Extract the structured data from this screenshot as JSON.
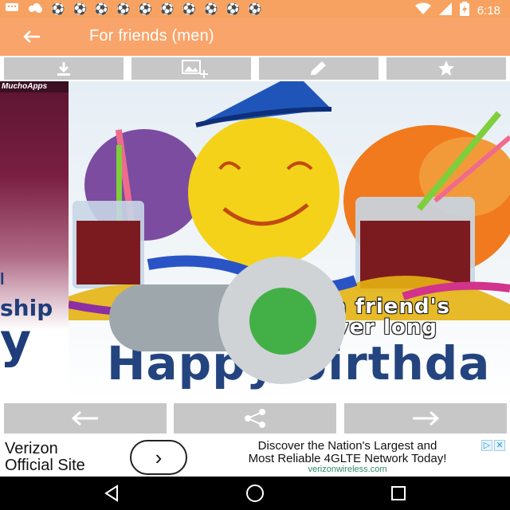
{
  "status_bar": {
    "time": "6:18",
    "notification_icons": [
      "message-icon",
      "cloud-icon",
      "soccer-ball-icon",
      "soccer-ball-icon",
      "soccer-ball-icon",
      "soccer-ball-icon",
      "soccer-ball-icon",
      "soccer-ball-icon",
      "soccer-ball-icon",
      "soccer-ball-icon",
      "soccer-ball-icon",
      "soccer-ball-icon"
    ],
    "right_icons": [
      "wifi-icon",
      "signal-icon",
      "battery-charging-icon"
    ]
  },
  "app_bar": {
    "title": "For friends (men)",
    "background_color": "#f9a46a"
  },
  "toolbar": {
    "buttons": [
      {
        "name": "download-button",
        "icon": "download-icon"
      },
      {
        "name": "set-wallpaper-button",
        "icon": "image-add-icon"
      },
      {
        "name": "edit-button",
        "icon": "pencil-icon"
      },
      {
        "name": "favorite-button",
        "icon": "star-icon"
      }
    ]
  },
  "card_previous": {
    "brand": "MuchoApps",
    "text_fragment_1": "ship",
    "text_fragment_2": "y",
    "text_fragment_3": "l"
  },
  "card_main": {
    "line1": "The road to a friend's",
    "line2": "house is never long",
    "headline": "Happy birthda"
  },
  "toggle": {
    "state": "on",
    "on_color": "#43b047",
    "track_color": "#9ea7ac",
    "knob_color": "#cfd3d6"
  },
  "navigation": {
    "buttons": [
      {
        "name": "previous-button",
        "icon": "arrow-left-icon"
      },
      {
        "name": "share-button",
        "icon": "share-icon"
      },
      {
        "name": "next-button",
        "icon": "arrow-right-icon"
      }
    ]
  },
  "ad": {
    "brand_line1": "Verizon",
    "brand_line2": "Official Site",
    "go_symbol": "›",
    "message_line1": "Discover the Nation's Largest and",
    "message_line2": "Most Reliable 4GLTE Network Today!",
    "url": "verizonwireless.com",
    "adchoices_glyph": "▷",
    "close_glyph": "✕"
  },
  "system_nav": {
    "buttons": [
      "back-icon",
      "home-icon",
      "recents-icon"
    ]
  }
}
